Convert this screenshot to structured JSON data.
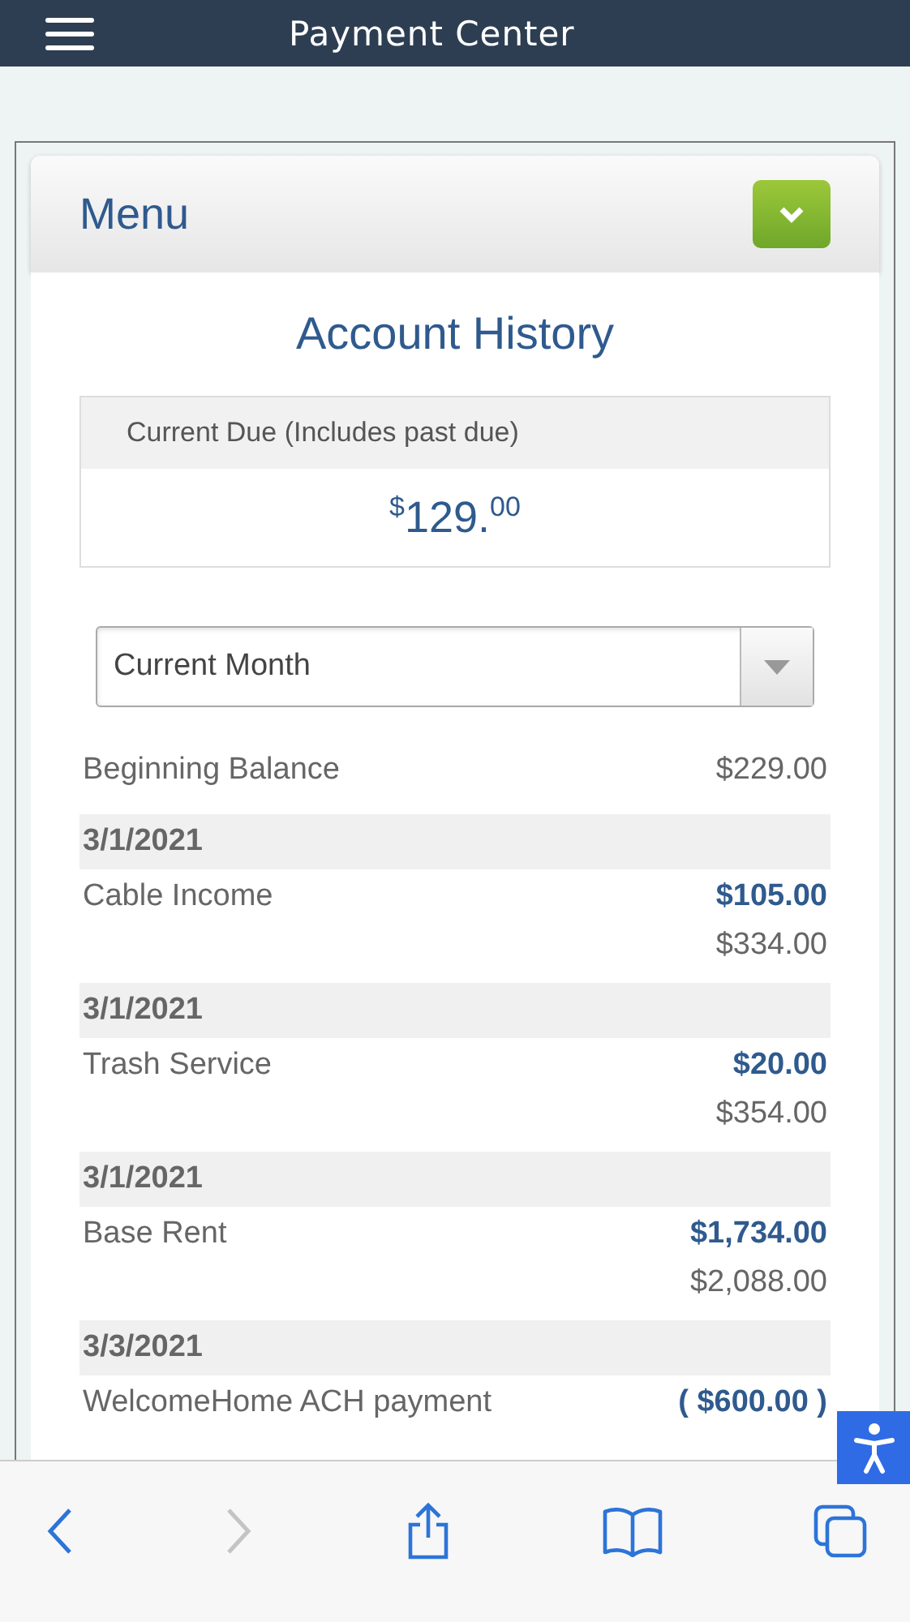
{
  "header": {
    "title": "Payment Center"
  },
  "menu": {
    "title": "Menu",
    "expanded": false
  },
  "page_title": "Account History",
  "current_due": {
    "label": "Current Due (Includes past due)",
    "currency": "$",
    "whole": "129.",
    "cents": "00"
  },
  "period_select": {
    "value": "Current Month"
  },
  "beginning_balance": {
    "label": "Beginning Balance",
    "amount": "$229.00"
  },
  "transactions": [
    {
      "date": "3/1/2021",
      "description": "Cable Income",
      "amount": "$105.00",
      "balance": "$334.00"
    },
    {
      "date": "3/1/2021",
      "description": "Trash Service",
      "amount": "$20.00",
      "balance": "$354.00"
    },
    {
      "date": "3/1/2021",
      "description": "Base Rent",
      "amount": "$1,734.00",
      "balance": "$2,088.00"
    },
    {
      "date": "3/3/2021",
      "description": "WelcomeHome ACH payment",
      "amount": "( $600.00 )"
    }
  ],
  "browser_toolbar": [
    {
      "kind": "back",
      "disabled": false
    },
    {
      "kind": "forward",
      "disabled": true
    },
    {
      "kind": "share",
      "disabled": false
    },
    {
      "kind": "bookmarks",
      "disabled": false
    },
    {
      "kind": "tabs",
      "disabled": false
    }
  ]
}
